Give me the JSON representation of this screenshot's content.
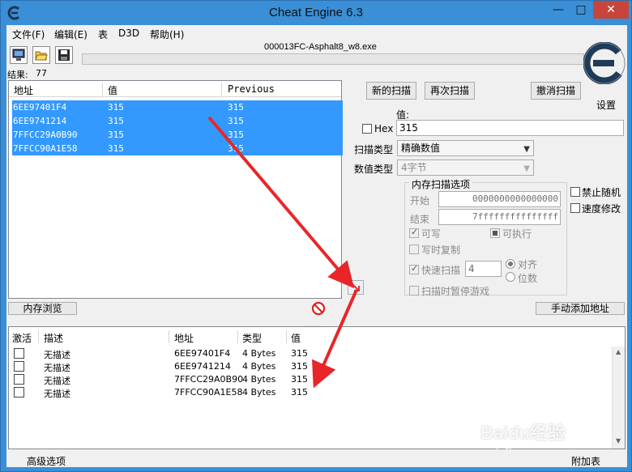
{
  "window": {
    "title": "Cheat Engine 6.3",
    "minimize": "—",
    "maximize": "□",
    "close": "✕"
  },
  "menu": [
    "文件(F)",
    "编辑(E)",
    "表",
    "D3D",
    "帮助(H)"
  ],
  "process": {
    "name": "000013FC-Asphalt8_w8.exe"
  },
  "results": {
    "label": "结果:",
    "count": "77"
  },
  "scan_list": {
    "columns": [
      "地址",
      "值",
      "Previous"
    ],
    "rows": [
      {
        "address": "6EE97401F4",
        "value": "315",
        "previous": "315"
      },
      {
        "address": "6EE9741214",
        "value": "315",
        "previous": "315"
      },
      {
        "address": "7FFCC29A0B90",
        "value": "315",
        "previous": "315"
      },
      {
        "address": "7FFCC90A1E58",
        "value": "315",
        "previous": "315"
      }
    ]
  },
  "buttons": {
    "new_scan": "新的扫描",
    "next_scan": "再次扫描",
    "undo_scan": "撤消扫描",
    "settings": "设置",
    "memory_view": "内存浏览",
    "add_address": "手动添加地址"
  },
  "scan_options": {
    "value_label": "值:",
    "hex_label": "Hex",
    "value": "315",
    "scan_type_label": "扫描类型",
    "scan_type": "精确数值",
    "value_type_label": "数值类型",
    "value_type": "4字节",
    "memory_group_title": "内存扫描选项",
    "start_label": "开始",
    "start_value": "0000000000000000",
    "stop_label": "结束",
    "stop_value": "7fffffffffffffff",
    "writable": "可写",
    "executable": "可执行",
    "copy_on_write": "写时复制",
    "fast_scan": "快速扫描",
    "fast_scan_value": "4",
    "alignment": "对齐",
    "last_digits": "位数",
    "pause_game": "扫描时暂停游戏",
    "unrandomizer": "禁止随机",
    "speedhack": "速度修改"
  },
  "address_list": {
    "columns": [
      "激活",
      "描述",
      "地址",
      "类型",
      "值"
    ],
    "rows": [
      {
        "description": "无描述",
        "address": "6EE97401F4",
        "type": "4 Bytes",
        "value": "315"
      },
      {
        "description": "无描述",
        "address": "6EE9741214",
        "type": "4 Bytes",
        "value": "315"
      },
      {
        "description": "无描述",
        "address": "7FFCC29A0B90",
        "type": "4 Bytes",
        "value": "315"
      },
      {
        "description": "无描述",
        "address": "7FFCC90A1E58",
        "type": "4 Bytes",
        "value": "315"
      }
    ]
  },
  "footer": {
    "advanced": "高级选项",
    "table_extras": "附加表"
  },
  "watermark": {
    "brand": "Baidu经验",
    "url": "jingyan.baidu.com"
  },
  "colors": {
    "titlebar": "#3a8fd6",
    "selection": "#3399ff",
    "arrow": "#e8262a",
    "close": "#c7453a"
  }
}
